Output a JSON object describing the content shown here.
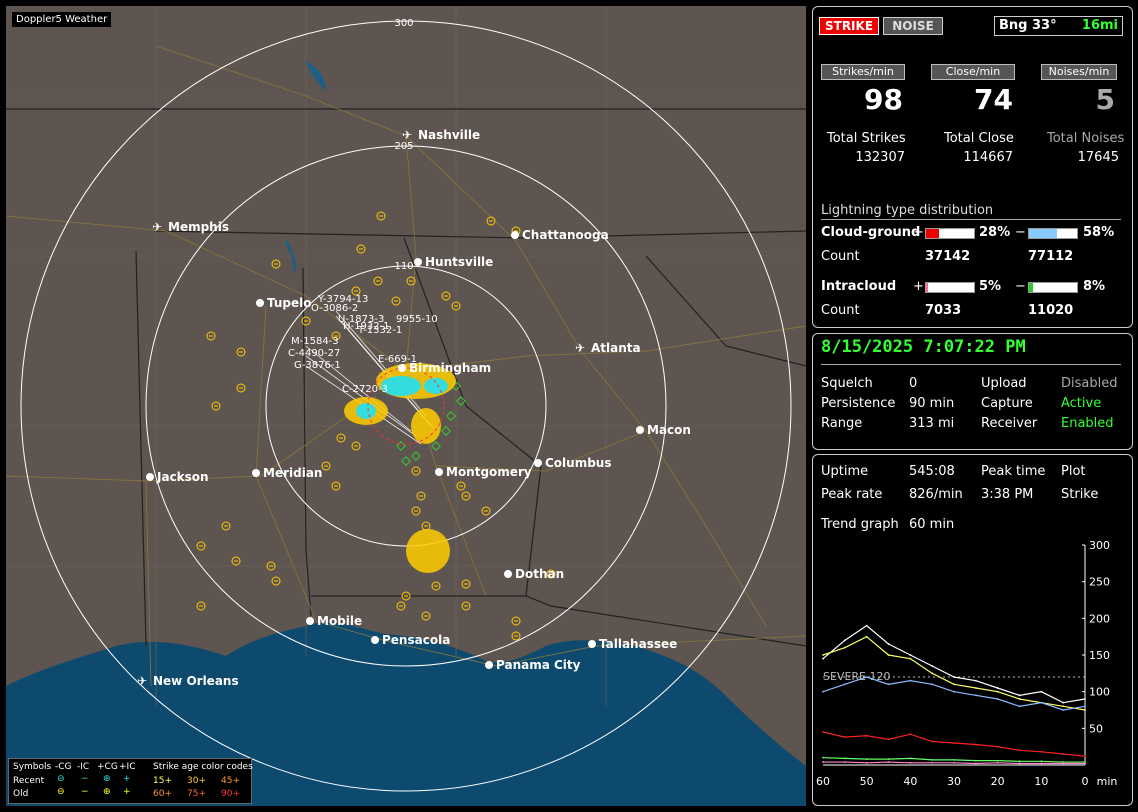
{
  "app": {
    "title": "Doppler5 Weather"
  },
  "map": {
    "range_rings": [
      "300",
      "205",
      "110"
    ],
    "cities": [
      {
        "name": "Nashville",
        "airport": true
      },
      {
        "name": "Memphis",
        "airport": true
      },
      {
        "name": "Chattanooga",
        "airport": false
      },
      {
        "name": "Huntsville",
        "airport": false
      },
      {
        "name": "Tupelo",
        "airport": false
      },
      {
        "name": "Atlanta",
        "airport": true
      },
      {
        "name": "Birmingham",
        "airport": false
      },
      {
        "name": "Macon",
        "airport": false
      },
      {
        "name": "Jackson",
        "airport": false
      },
      {
        "name": "Meridian",
        "airport": false
      },
      {
        "name": "Montgomery",
        "airport": false
      },
      {
        "name": "Columbus",
        "airport": false
      },
      {
        "name": "Dothan",
        "airport": false
      },
      {
        "name": "Mobile",
        "airport": false
      },
      {
        "name": "Pensacola",
        "airport": false
      },
      {
        "name": "Tallahassee",
        "airport": false
      },
      {
        "name": "Panama City",
        "airport": false
      },
      {
        "name": "New Orleans",
        "airport": true
      }
    ],
    "storm_labels": [
      "Y-3794-13",
      "O-3086-2",
      "U-1873-3",
      "T-1332-1",
      "H-1932-1",
      "9955-10",
      "M-1584-3",
      "C-4490-27",
      "G-3876-1",
      "E-669-1",
      "C-2720-3"
    ]
  },
  "legend": {
    "symbols_label": "Symbols",
    "headers": [
      "-CG",
      "-IC",
      "+CG",
      "+IC"
    ],
    "rows": [
      {
        "label": "Recent",
        "ages": [
          "15+",
          "30+",
          "45+"
        ]
      },
      {
        "label": "Old",
        "ages": [
          "60+",
          "75+",
          "90+"
        ]
      }
    ],
    "age_title": "Strike age color codes"
  },
  "strike_panel": {
    "strike_btn": "STRIKE",
    "noise_btn": "NOISE",
    "bearing": "Bng 33°",
    "distance": "16mi",
    "headers": [
      "Strikes/min",
      "Close/min",
      "Noises/min"
    ],
    "rates": [
      "98",
      "74",
      "5"
    ],
    "total_labels": [
      "Total Strikes",
      "Total Close",
      "Total Noises"
    ],
    "totals": [
      "132307",
      "114667",
      "17645"
    ],
    "dist_title": "Lightning type distribution",
    "cloud_ground": {
      "label": "Cloud-ground",
      "plus": "+",
      "minus": "−",
      "pos_pct": "28%",
      "neg_pct": "58%",
      "pos_frac": 0.28,
      "neg_frac": 0.58,
      "count_label": "Count",
      "pos_count": "37142",
      "neg_count": "77112"
    },
    "intracloud": {
      "label": "Intracloud",
      "plus": "+",
      "minus": "−",
      "pos_pct": "5%",
      "neg_pct": "8%",
      "pos_frac": 0.05,
      "neg_frac": 0.08,
      "count_label": "Count",
      "pos_count": "7033",
      "neg_count": "11020"
    }
  },
  "status_panel": {
    "datetime": "8/15/2025 7:07:22 PM",
    "rows": [
      {
        "k1": "Squelch",
        "v1": "0",
        "k2": "Upload",
        "v2": "Disabled",
        "v2_color": "#aaaaaa"
      },
      {
        "k1": "Persistence",
        "v1": "90 min",
        "k2": "Capture",
        "v2": "Active",
        "v2_color": "#33ff33"
      },
      {
        "k1": "Range",
        "v1": "313 mi",
        "k2": "Receiver",
        "v2": "Enabled",
        "v2_color": "#33ff33"
      }
    ]
  },
  "trend_panel": {
    "uptime_label": "Uptime",
    "uptime": "545:08",
    "peak_time_label": "Peak time",
    "peak_time": "3:38 PM",
    "plot_label": "Plot",
    "peak_rate_label": "Peak rate",
    "peak_rate": "826/min",
    "plot_value": "Strike",
    "trend_label": "Trend graph",
    "trend_value": "60 min",
    "severe_label": "SEVERE 120",
    "y_ticks": [
      "300",
      "250",
      "200",
      "150",
      "100",
      "50"
    ],
    "x_ticks": [
      "60",
      "50",
      "40",
      "30",
      "20",
      "10",
      "0",
      "min"
    ]
  },
  "chart_data": {
    "type": "line",
    "title": "",
    "xlabel": "min",
    "ylabel": "",
    "xlim": [
      60,
      0
    ],
    "ylim": [
      0,
      300
    ],
    "threshold": 120,
    "x": [
      60,
      55,
      50,
      45,
      40,
      35,
      30,
      25,
      20,
      15,
      10,
      5,
      0
    ],
    "series": [
      {
        "color": "#ffffff",
        "values": [
          145,
          170,
          190,
          165,
          150,
          135,
          120,
          115,
          105,
          95,
          100,
          85,
          90
        ]
      },
      {
        "color": "#ffff66",
        "values": [
          150,
          160,
          175,
          150,
          145,
          125,
          110,
          105,
          100,
          90,
          85,
          80,
          75
        ]
      },
      {
        "color": "#88bbff",
        "values": [
          100,
          110,
          120,
          110,
          115,
          110,
          100,
          95,
          90,
          80,
          85,
          75,
          80
        ]
      },
      {
        "color": "#ff2222",
        "values": [
          45,
          38,
          40,
          35,
          42,
          32,
          30,
          28,
          25,
          20,
          18,
          15,
          12
        ]
      },
      {
        "color": "#66ff66",
        "values": [
          10,
          9,
          8,
          8,
          9,
          7,
          7,
          6,
          6,
          5,
          5,
          4,
          4
        ]
      },
      {
        "color": "#ff88cc",
        "values": [
          4,
          4,
          3,
          4,
          3,
          3,
          3,
          2,
          3,
          2,
          2,
          2,
          2
        ]
      }
    ]
  }
}
